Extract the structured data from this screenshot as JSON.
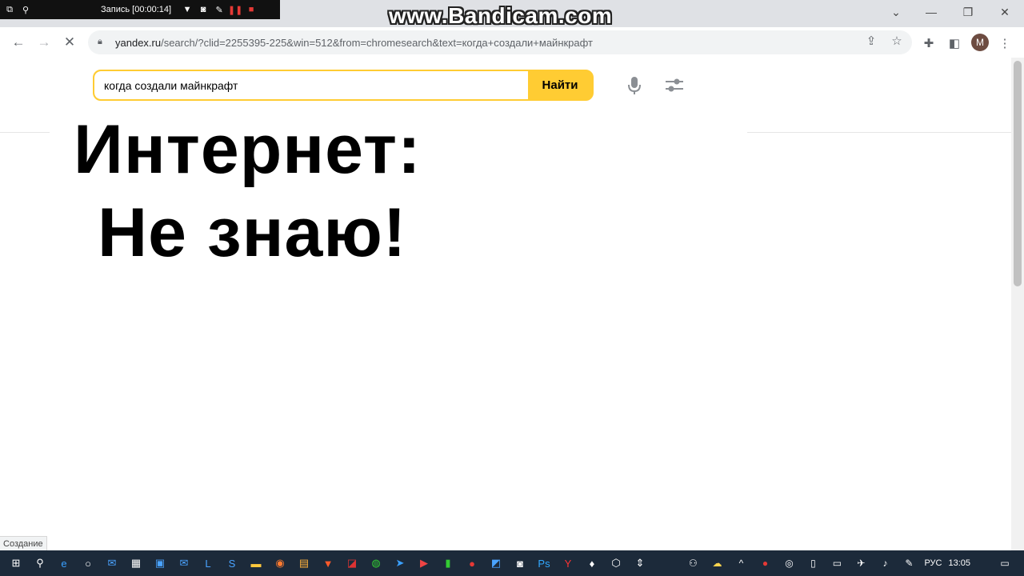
{
  "bandicam": {
    "recording_label": "Запись [00:00:14]",
    "watermark": "www.Bandicam.com"
  },
  "browser": {
    "url_host": "yandex.ru",
    "url_path": "/search/?clid=2255395-225&win=512&from=chromesearch&text=когда+создали+майнкрафт",
    "avatar_letter": "M"
  },
  "search": {
    "query": "когда создали майнкрафт",
    "button_label": "Найти"
  },
  "meme": {
    "line1": "Интернет:",
    "line2": "Не знаю!"
  },
  "status": {
    "text": "Создание"
  },
  "taskbar": {
    "lang": "РУС",
    "time": "13:05"
  },
  "colors": {
    "yandex_yellow": "#ffcc33",
    "taskbar": "#1c2a3a"
  }
}
